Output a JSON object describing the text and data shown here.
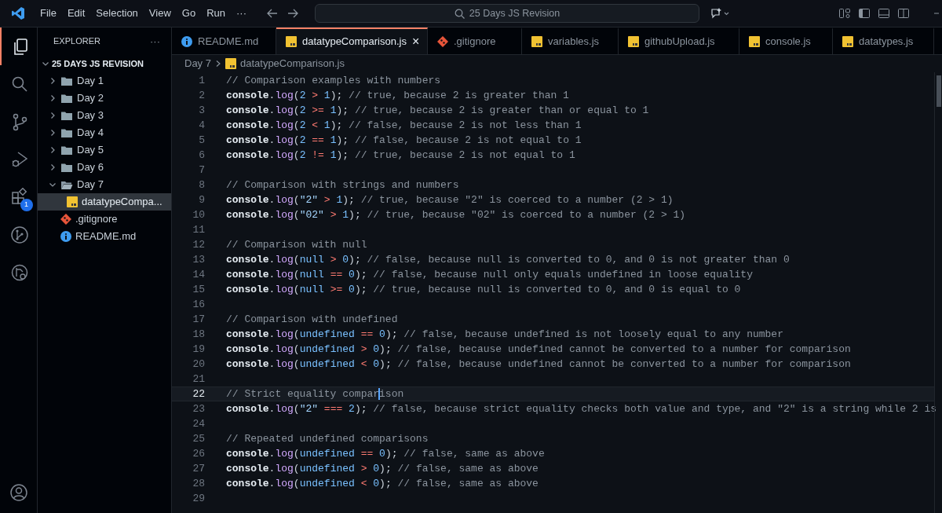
{
  "menu": [
    "File",
    "Edit",
    "Selection",
    "View",
    "Go",
    "Run",
    "···"
  ],
  "command_center": {
    "text": "25 Days JS Revision"
  },
  "activity_bar": [
    {
      "kind": "files",
      "selected": true
    },
    {
      "kind": "search",
      "selected": false
    },
    {
      "kind": "source-control",
      "selected": false
    },
    {
      "kind": "run-debug",
      "selected": false
    },
    {
      "kind": "extensions",
      "selected": false,
      "badge": "1"
    },
    {
      "kind": "branch",
      "selected": false
    },
    {
      "kind": "remote",
      "selected": false
    }
  ],
  "sidebar": {
    "title": "EXPLORER",
    "more": "···",
    "root": {
      "label": "25 DAYS JS REVISION",
      "expanded": true,
      "children": [
        {
          "kind": "folder",
          "label": "Day 1",
          "expanded": false,
          "selected": false
        },
        {
          "kind": "folder",
          "label": "Day 2",
          "expanded": false,
          "selected": false
        },
        {
          "kind": "folder",
          "label": "Day 3",
          "expanded": false,
          "selected": false
        },
        {
          "kind": "folder",
          "label": "Day 4",
          "expanded": false,
          "selected": false
        },
        {
          "kind": "folder",
          "label": "Day 5",
          "expanded": false,
          "selected": false
        },
        {
          "kind": "folder",
          "label": "Day 6",
          "expanded": false,
          "selected": false
        },
        {
          "kind": "folder",
          "label": "Day 7",
          "expanded": true,
          "selected": false,
          "children": [
            {
              "kind": "js",
              "label": "datatypeCompa...",
              "selected": true
            }
          ]
        },
        {
          "kind": "git",
          "label": ".gitignore",
          "selected": false
        },
        {
          "kind": "info",
          "label": "README.md",
          "selected": false
        }
      ]
    }
  },
  "tabs": [
    {
      "kind": "info",
      "label": "README.md",
      "selected": false
    },
    {
      "kind": "js",
      "label": "datatypeComparison.js",
      "selected": true,
      "close": "×"
    },
    {
      "kind": "git",
      "label": ".gitignore",
      "selected": false
    },
    {
      "kind": "js",
      "label": "variables.js",
      "selected": false
    },
    {
      "kind": "js",
      "label": "githubUpload.js",
      "selected": false
    },
    {
      "kind": "js",
      "label": "console.js",
      "selected": false
    },
    {
      "kind": "js",
      "label": "datatypes.js",
      "selected": false
    }
  ],
  "breadcrumb": [
    {
      "kind": "folder",
      "label": "Day 7"
    },
    {
      "kind": "js",
      "label": "datatypeComparison.js"
    }
  ],
  "lines": [
    {
      "number": "1",
      "current": false,
      "tokens": [
        {
          "kind": "c",
          "text": "// Comparison examples with numbers"
        }
      ]
    },
    {
      "number": "2",
      "current": false,
      "tokens": [
        {
          "kind": "id",
          "text": "console"
        },
        {
          "kind": "p",
          "text": "."
        },
        {
          "kind": "fn",
          "text": "log"
        },
        {
          "kind": "p",
          "text": "("
        },
        {
          "kind": "n",
          "text": "2"
        },
        {
          "kind": "o",
          "text": " > "
        },
        {
          "kind": "n",
          "text": "1"
        },
        {
          "kind": "p",
          "text": "); "
        },
        {
          "kind": "c",
          "text": "// true, because 2 is greater than 1"
        }
      ]
    },
    {
      "number": "3",
      "current": false,
      "tokens": [
        {
          "kind": "id",
          "text": "console"
        },
        {
          "kind": "p",
          "text": "."
        },
        {
          "kind": "fn",
          "text": "log"
        },
        {
          "kind": "p",
          "text": "("
        },
        {
          "kind": "n",
          "text": "2"
        },
        {
          "kind": "o",
          "text": " >= "
        },
        {
          "kind": "n",
          "text": "1"
        },
        {
          "kind": "p",
          "text": "); "
        },
        {
          "kind": "c",
          "text": "// true, because 2 is greater than or equal to 1"
        }
      ]
    },
    {
      "number": "4",
      "current": false,
      "tokens": [
        {
          "kind": "id",
          "text": "console"
        },
        {
          "kind": "p",
          "text": "."
        },
        {
          "kind": "fn",
          "text": "log"
        },
        {
          "kind": "p",
          "text": "("
        },
        {
          "kind": "n",
          "text": "2"
        },
        {
          "kind": "o",
          "text": " < "
        },
        {
          "kind": "n",
          "text": "1"
        },
        {
          "kind": "p",
          "text": "); "
        },
        {
          "kind": "c",
          "text": "// false, because 2 is not less than 1"
        }
      ]
    },
    {
      "number": "5",
      "current": false,
      "tokens": [
        {
          "kind": "id",
          "text": "console"
        },
        {
          "kind": "p",
          "text": "."
        },
        {
          "kind": "fn",
          "text": "log"
        },
        {
          "kind": "p",
          "text": "("
        },
        {
          "kind": "n",
          "text": "2"
        },
        {
          "kind": "o",
          "text": " == "
        },
        {
          "kind": "n",
          "text": "1"
        },
        {
          "kind": "p",
          "text": "); "
        },
        {
          "kind": "c",
          "text": "// false, because 2 is not equal to 1"
        }
      ]
    },
    {
      "number": "6",
      "current": false,
      "tokens": [
        {
          "kind": "id",
          "text": "console"
        },
        {
          "kind": "p",
          "text": "."
        },
        {
          "kind": "fn",
          "text": "log"
        },
        {
          "kind": "p",
          "text": "("
        },
        {
          "kind": "n",
          "text": "2"
        },
        {
          "kind": "o",
          "text": " != "
        },
        {
          "kind": "n",
          "text": "1"
        },
        {
          "kind": "p",
          "text": "); "
        },
        {
          "kind": "c",
          "text": "// true, because 2 is not equal to 1"
        }
      ]
    },
    {
      "number": "7",
      "current": false
    },
    {
      "number": "8",
      "current": false,
      "tokens": [
        {
          "kind": "c",
          "text": "// Comparison with strings and numbers"
        }
      ]
    },
    {
      "number": "9",
      "current": false,
      "tokens": [
        {
          "kind": "id",
          "text": "console"
        },
        {
          "kind": "p",
          "text": "."
        },
        {
          "kind": "fn",
          "text": "log"
        },
        {
          "kind": "p",
          "text": "("
        },
        {
          "kind": "s",
          "text": "\"2\""
        },
        {
          "kind": "o",
          "text": " > "
        },
        {
          "kind": "n",
          "text": "1"
        },
        {
          "kind": "p",
          "text": "); "
        },
        {
          "kind": "c",
          "text": "// true, because \"2\" is coerced to a number (2 > 1)"
        }
      ]
    },
    {
      "number": "10",
      "current": false,
      "tokens": [
        {
          "kind": "id",
          "text": "console"
        },
        {
          "kind": "p",
          "text": "."
        },
        {
          "kind": "fn",
          "text": "log"
        },
        {
          "kind": "p",
          "text": "("
        },
        {
          "kind": "s",
          "text": "\"02\""
        },
        {
          "kind": "o",
          "text": " > "
        },
        {
          "kind": "n",
          "text": "1"
        },
        {
          "kind": "p",
          "text": "); "
        },
        {
          "kind": "c",
          "text": "// true, because \"02\" is coerced to a number (2 > 1)"
        }
      ]
    },
    {
      "number": "11",
      "current": false
    },
    {
      "number": "12",
      "current": false,
      "tokens": [
        {
          "kind": "c",
          "text": "// Comparison with null"
        }
      ]
    },
    {
      "number": "13",
      "current": false,
      "tokens": [
        {
          "kind": "id",
          "text": "console"
        },
        {
          "kind": "p",
          "text": "."
        },
        {
          "kind": "fn",
          "text": "log"
        },
        {
          "kind": "p",
          "text": "("
        },
        {
          "kind": "k",
          "text": "null"
        },
        {
          "kind": "o",
          "text": " > "
        },
        {
          "kind": "n",
          "text": "0"
        },
        {
          "kind": "p",
          "text": "); "
        },
        {
          "kind": "c",
          "text": "// false, because null is converted to 0, and 0 is not greater than 0"
        }
      ]
    },
    {
      "number": "14",
      "current": false,
      "tokens": [
        {
          "kind": "id",
          "text": "console"
        },
        {
          "kind": "p",
          "text": "."
        },
        {
          "kind": "fn",
          "text": "log"
        },
        {
          "kind": "p",
          "text": "("
        },
        {
          "kind": "k",
          "text": "null"
        },
        {
          "kind": "o",
          "text": " == "
        },
        {
          "kind": "n",
          "text": "0"
        },
        {
          "kind": "p",
          "text": "); "
        },
        {
          "kind": "c",
          "text": "// false, because null only equals undefined in loose equality"
        }
      ]
    },
    {
      "number": "15",
      "current": false,
      "tokens": [
        {
          "kind": "id",
          "text": "console"
        },
        {
          "kind": "p",
          "text": "."
        },
        {
          "kind": "fn",
          "text": "log"
        },
        {
          "kind": "p",
          "text": "("
        },
        {
          "kind": "k",
          "text": "null"
        },
        {
          "kind": "o",
          "text": " >= "
        },
        {
          "kind": "n",
          "text": "0"
        },
        {
          "kind": "p",
          "text": "); "
        },
        {
          "kind": "c",
          "text": "// true, because null is converted to 0, and 0 is equal to 0"
        }
      ]
    },
    {
      "number": "16",
      "current": false
    },
    {
      "number": "17",
      "current": false,
      "tokens": [
        {
          "kind": "c",
          "text": "// Comparison with undefined"
        }
      ]
    },
    {
      "number": "18",
      "current": false,
      "tokens": [
        {
          "kind": "id",
          "text": "console"
        },
        {
          "kind": "p",
          "text": "."
        },
        {
          "kind": "fn",
          "text": "log"
        },
        {
          "kind": "p",
          "text": "("
        },
        {
          "kind": "k",
          "text": "undefined"
        },
        {
          "kind": "o",
          "text": " == "
        },
        {
          "kind": "n",
          "text": "0"
        },
        {
          "kind": "p",
          "text": "); "
        },
        {
          "kind": "c",
          "text": "// false, because undefined is not loosely equal to any number"
        }
      ]
    },
    {
      "number": "19",
      "current": false,
      "tokens": [
        {
          "kind": "id",
          "text": "console"
        },
        {
          "kind": "p",
          "text": "."
        },
        {
          "kind": "fn",
          "text": "log"
        },
        {
          "kind": "p",
          "text": "("
        },
        {
          "kind": "k",
          "text": "undefined"
        },
        {
          "kind": "o",
          "text": " > "
        },
        {
          "kind": "n",
          "text": "0"
        },
        {
          "kind": "p",
          "text": "); "
        },
        {
          "kind": "c",
          "text": "// false, because undefined cannot be converted to a number for comparison"
        }
      ]
    },
    {
      "number": "20",
      "current": false,
      "tokens": [
        {
          "kind": "id",
          "text": "console"
        },
        {
          "kind": "p",
          "text": "."
        },
        {
          "kind": "fn",
          "text": "log"
        },
        {
          "kind": "p",
          "text": "("
        },
        {
          "kind": "k",
          "text": "undefined"
        },
        {
          "kind": "o",
          "text": " < "
        },
        {
          "kind": "n",
          "text": "0"
        },
        {
          "kind": "p",
          "text": "); "
        },
        {
          "kind": "c",
          "text": "// false, because undefined cannot be converted to a number for comparison"
        }
      ]
    },
    {
      "number": "21",
      "current": false
    },
    {
      "number": "22",
      "current": true,
      "tokens": [
        {
          "kind": "c",
          "text": "// Strict equality compar"
        },
        {
          "kind": "c",
          "text": "ison",
          "cursor_before": true
        }
      ]
    },
    {
      "number": "23",
      "current": false,
      "tokens": [
        {
          "kind": "id",
          "text": "console"
        },
        {
          "kind": "p",
          "text": "."
        },
        {
          "kind": "fn",
          "text": "log"
        },
        {
          "kind": "p",
          "text": "("
        },
        {
          "kind": "s",
          "text": "\"2\""
        },
        {
          "kind": "o",
          "text": " === "
        },
        {
          "kind": "n",
          "text": "2"
        },
        {
          "kind": "p",
          "text": "); "
        },
        {
          "kind": "c",
          "text": "// false, because strict equality checks both value and type, and \"2\" is a string while 2 is"
        }
      ]
    },
    {
      "number": "24",
      "current": false
    },
    {
      "number": "25",
      "current": false,
      "tokens": [
        {
          "kind": "c",
          "text": "// Repeated undefined comparisons"
        }
      ]
    },
    {
      "number": "26",
      "current": false,
      "tokens": [
        {
          "kind": "id",
          "text": "console"
        },
        {
          "kind": "p",
          "text": "."
        },
        {
          "kind": "fn",
          "text": "log"
        },
        {
          "kind": "p",
          "text": "("
        },
        {
          "kind": "k",
          "text": "undefined"
        },
        {
          "kind": "o",
          "text": " == "
        },
        {
          "kind": "n",
          "text": "0"
        },
        {
          "kind": "p",
          "text": "); "
        },
        {
          "kind": "c",
          "text": "// false, same as above"
        }
      ]
    },
    {
      "number": "27",
      "current": false,
      "tokens": [
        {
          "kind": "id",
          "text": "console"
        },
        {
          "kind": "p",
          "text": "."
        },
        {
          "kind": "fn",
          "text": "log"
        },
        {
          "kind": "p",
          "text": "("
        },
        {
          "kind": "k",
          "text": "undefined"
        },
        {
          "kind": "o",
          "text": " > "
        },
        {
          "kind": "n",
          "text": "0"
        },
        {
          "kind": "p",
          "text": "); "
        },
        {
          "kind": "c",
          "text": "// false, same as above"
        }
      ]
    },
    {
      "number": "28",
      "current": false,
      "tokens": [
        {
          "kind": "id",
          "text": "console"
        },
        {
          "kind": "p",
          "text": "."
        },
        {
          "kind": "fn",
          "text": "log"
        },
        {
          "kind": "p",
          "text": "("
        },
        {
          "kind": "k",
          "text": "undefined"
        },
        {
          "kind": "o",
          "text": " < "
        },
        {
          "kind": "n",
          "text": "0"
        },
        {
          "kind": "p",
          "text": "); "
        },
        {
          "kind": "c",
          "text": "// false, same as above"
        }
      ]
    },
    {
      "number": "29",
      "current": false
    }
  ]
}
